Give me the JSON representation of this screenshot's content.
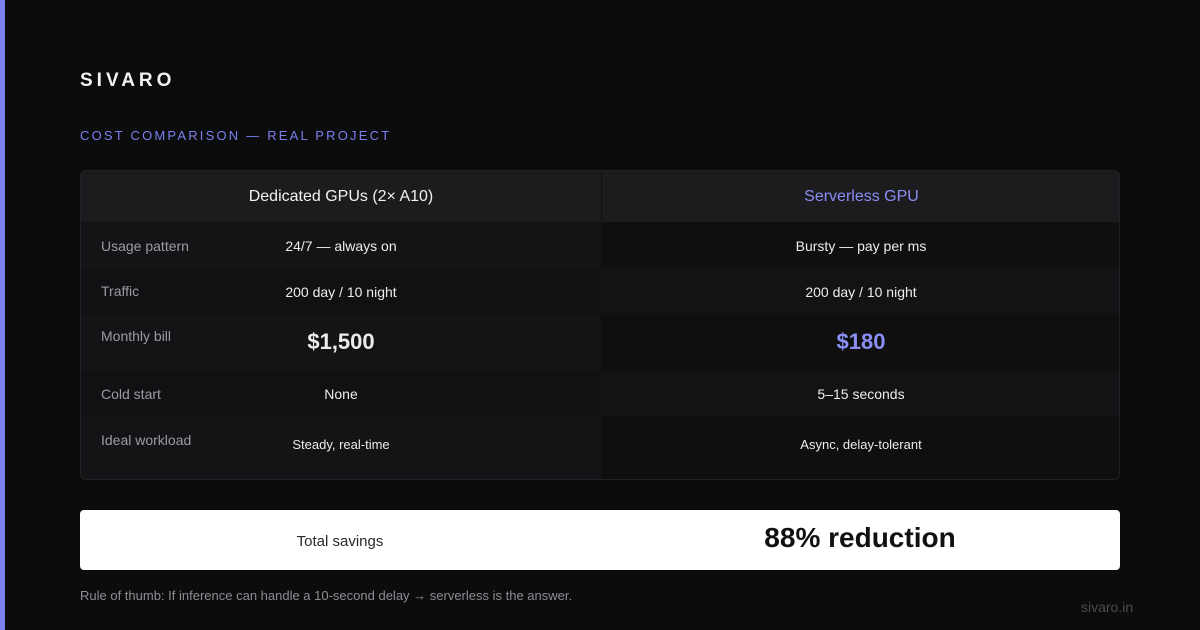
{
  "brand": "SIVARO",
  "eyebrow": "COST COMPARISON — REAL PROJECT",
  "columns": {
    "dedicated": "Dedicated GPUs (2× A10)",
    "serverless": "Serverless GPU"
  },
  "rows": [
    {
      "label": "Usage pattern",
      "dedicated": "24/7 — always on",
      "serverless": "Bursty — pay per ms"
    },
    {
      "label": "Traffic",
      "dedicated": "200 day / 10 night",
      "serverless": "200 day / 10 night"
    },
    {
      "label": "Monthly bill",
      "dedicated": "$1,500",
      "serverless": "$180"
    },
    {
      "label": "Cold start",
      "dedicated": "None",
      "serverless": "5–15 seconds"
    },
    {
      "label": "Ideal workload",
      "dedicated": "Steady, real-time",
      "serverless": "Async, delay-tolerant"
    }
  ],
  "savings": {
    "label": "Total savings",
    "value": "88% reduction"
  },
  "footnote": "Rule of thumb: If inference can handle a 10-second delay → serverless is the answer.",
  "site": "sivaro.in",
  "colors": {
    "accent": "#7b7ff0",
    "background": "#0c0c0d",
    "savings_bg": "#ffffff"
  }
}
